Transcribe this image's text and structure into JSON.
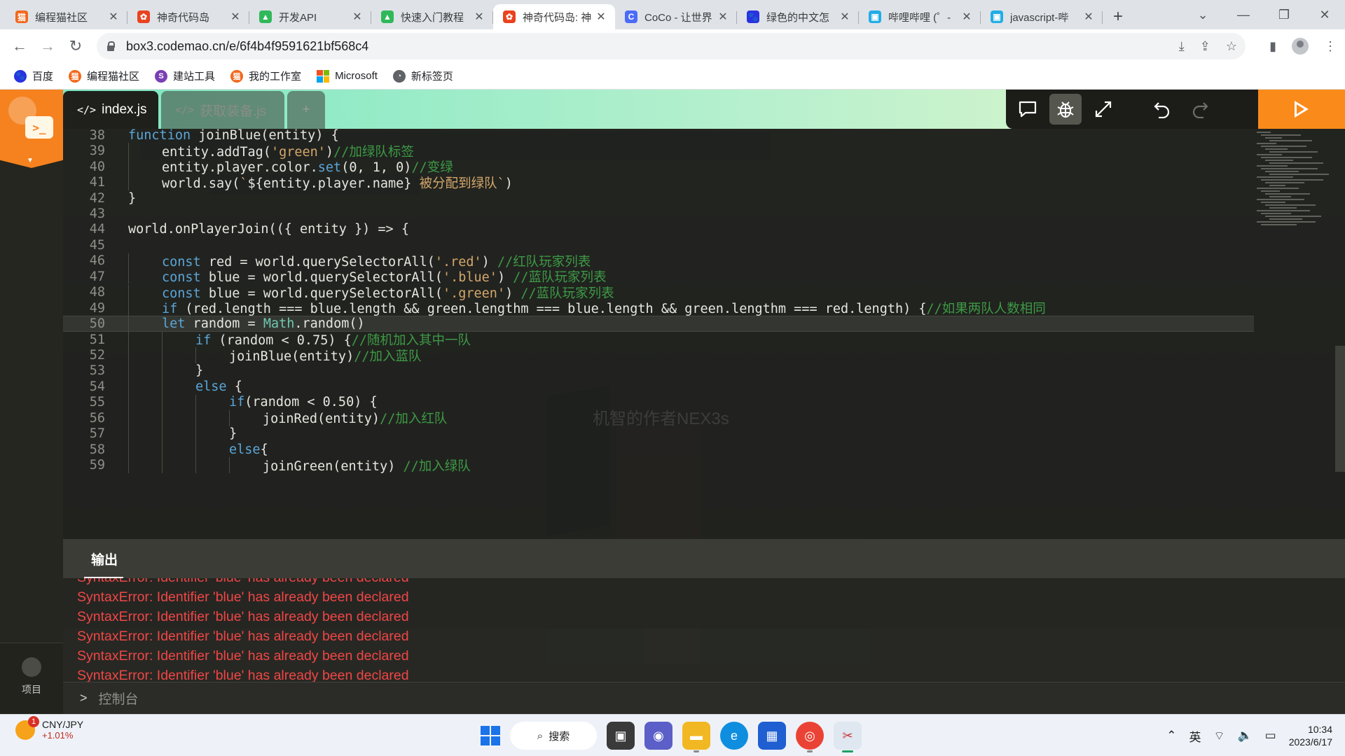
{
  "browser": {
    "tabs": [
      {
        "title": "编程猫社区",
        "icon": "codemao-community-icon",
        "color": "#f2681c",
        "glyph": "猫"
      },
      {
        "title": "神奇代码岛",
        "icon": "box3-icon",
        "color": "#e8431f",
        "glyph": "✿"
      },
      {
        "title": "开发API",
        "icon": "api-docs-icon",
        "color": "#30b85a",
        "glyph": "▲"
      },
      {
        "title": "快速入门教程",
        "icon": "tutorial-icon",
        "color": "#30b85a",
        "glyph": "▲"
      },
      {
        "title": "神奇代码岛: 神",
        "icon": "box3-icon",
        "color": "#e8431f",
        "glyph": "✿",
        "active": true
      },
      {
        "title": "CoCo - 让世界",
        "icon": "coco-icon",
        "color": "#4b6cf7",
        "glyph": "C"
      },
      {
        "title": "绿色的中文怎",
        "icon": "baidu-icon",
        "color": "#2932e1",
        "glyph": "🐾"
      },
      {
        "title": "哔哩哔哩 (゜-",
        "icon": "bilibili-icon",
        "color": "#23ade5",
        "glyph": "▣"
      },
      {
        "title": "javascript-哔",
        "icon": "bilibili-icon",
        "color": "#23ade5",
        "glyph": "▣"
      }
    ],
    "url": "box3.codemao.cn/e/6f4b4f9591621bf568c4",
    "bookmarks": [
      {
        "label": "百度",
        "icon": "baidu-icon",
        "color": "#2932e1",
        "glyph": "🐾"
      },
      {
        "label": "编程猫社区",
        "icon": "codemao-community-icon",
        "color": "#f2681c",
        "glyph": "猫"
      },
      {
        "label": "建站工具",
        "icon": "site-tool-icon",
        "color": "#7a3fb4",
        "glyph": "S"
      },
      {
        "label": "我的工作室",
        "icon": "studio-icon",
        "color": "#f2681c",
        "glyph": "猫"
      },
      {
        "label": "Microsoft",
        "icon": "microsoft-icon",
        "color": "#f25022",
        "glyph": ""
      },
      {
        "label": "新标签页",
        "icon": "new-tab-icon",
        "color": "#5f6368",
        "glyph": "◔"
      }
    ]
  },
  "editor": {
    "files": [
      {
        "name": "index.js",
        "active": true
      },
      {
        "name": "获取装备.js",
        "active": false
      }
    ],
    "add_tab": "+",
    "file_tag": "</>",
    "run_label": "",
    "current_line": 50,
    "watermark": "机智的作者NEX3s",
    "lines": [
      {
        "n": "38",
        "indent": 0,
        "html": "<span class='k'>function</span> joinBlue(entity) {"
      },
      {
        "n": "39",
        "indent": 1,
        "html": "entity.addTag(<span class='s'>'green'</span>)<span class='c'>//加绿队标签</span>"
      },
      {
        "n": "40",
        "indent": 1,
        "html": "entity.player.color.<span class='k'>set</span>(0, 1, 0)<span class='c'>//变绿</span>"
      },
      {
        "n": "41",
        "indent": 1,
        "html": "world.say(<span class='s'>`</span>${entity.player.name}<span class='s'> 被分配到绿队`</span>)"
      },
      {
        "n": "42",
        "indent": 0,
        "html": "}"
      },
      {
        "n": "43",
        "indent": 0,
        "html": ""
      },
      {
        "n": "44",
        "indent": 0,
        "html": "world.onPlayerJoin(({ entity }) =&gt; {"
      },
      {
        "n": "45",
        "indent": 0,
        "html": ""
      },
      {
        "n": "46",
        "indent": 1,
        "html": "<span class='k'>const</span> red = world.querySelectorAll(<span class='s'>'.red'</span>) <span class='c'>//红队玩家列表</span>"
      },
      {
        "n": "47",
        "indent": 1,
        "html": "<span class='k'>const</span> blue = world.querySelectorAll(<span class='s'>'.blue'</span>) <span class='c'>//蓝队玩家列表</span>"
      },
      {
        "n": "48",
        "indent": 1,
        "html": "<span class='k'>const</span> blue = world.querySelectorAll(<span class='s'>'.green'</span>) <span class='c'>//蓝队玩家列表</span>"
      },
      {
        "n": "49",
        "indent": 1,
        "html": "<span class='k'>if</span> (red.length === blue.length &amp;&amp; green.lengthm === blue.length &amp;&amp; green.lengthm === red.length) {<span class='c'>//如果两队人数相同</span>"
      },
      {
        "n": "50",
        "indent": 1,
        "html": "<span class='k'>let</span> random = <span class='t'>Math</span>.random()"
      },
      {
        "n": "51",
        "indent": 2,
        "html": "<span class='k'>if</span> (random &lt; 0.75) {<span class='c'>//随机加入其中一队</span>"
      },
      {
        "n": "52",
        "indent": 3,
        "html": "joinBlue(entity)<span class='c'>//加入蓝队</span>"
      },
      {
        "n": "53",
        "indent": 2,
        "html": "}"
      },
      {
        "n": "54",
        "indent": 2,
        "html": "<span class='k'>else</span> {"
      },
      {
        "n": "55",
        "indent": 3,
        "html": "<span class='k'>if</span>(random &lt; 0.50) {"
      },
      {
        "n": "56",
        "indent": 4,
        "html": "joinRed(entity)<span class='c'>//加入红队</span>"
      },
      {
        "n": "57",
        "indent": 3,
        "html": "}"
      },
      {
        "n": "58",
        "indent": 3,
        "html": "<span class='k'>else</span>{"
      },
      {
        "n": "59",
        "indent": 4,
        "html": "joinGreen(entity) <span class='c'>//加入绿队</span>"
      }
    ]
  },
  "output": {
    "tab_label": "输出",
    "errors": [
      "SyntaxError: Identifier 'blue' has already been declared",
      "SyntaxError: Identifier 'blue' has already been declared",
      "SyntaxError: Identifier 'blue' has already been declared",
      "SyntaxError: Identifier 'blue' has already been declared",
      "SyntaxError: Identifier 'blue' has already been declared",
      "SyntaxError: Identifier 'blue' has already been declared"
    ],
    "console_label": "控制台"
  },
  "sidebar": {
    "project_label": "项目"
  },
  "taskbar": {
    "ticker_name": "CNY/JPY",
    "ticker_change": "+1.01%",
    "ticker_badge": "1",
    "search_label": "搜索",
    "ime": "英",
    "time": "10:34",
    "date": "2023/6/17"
  }
}
